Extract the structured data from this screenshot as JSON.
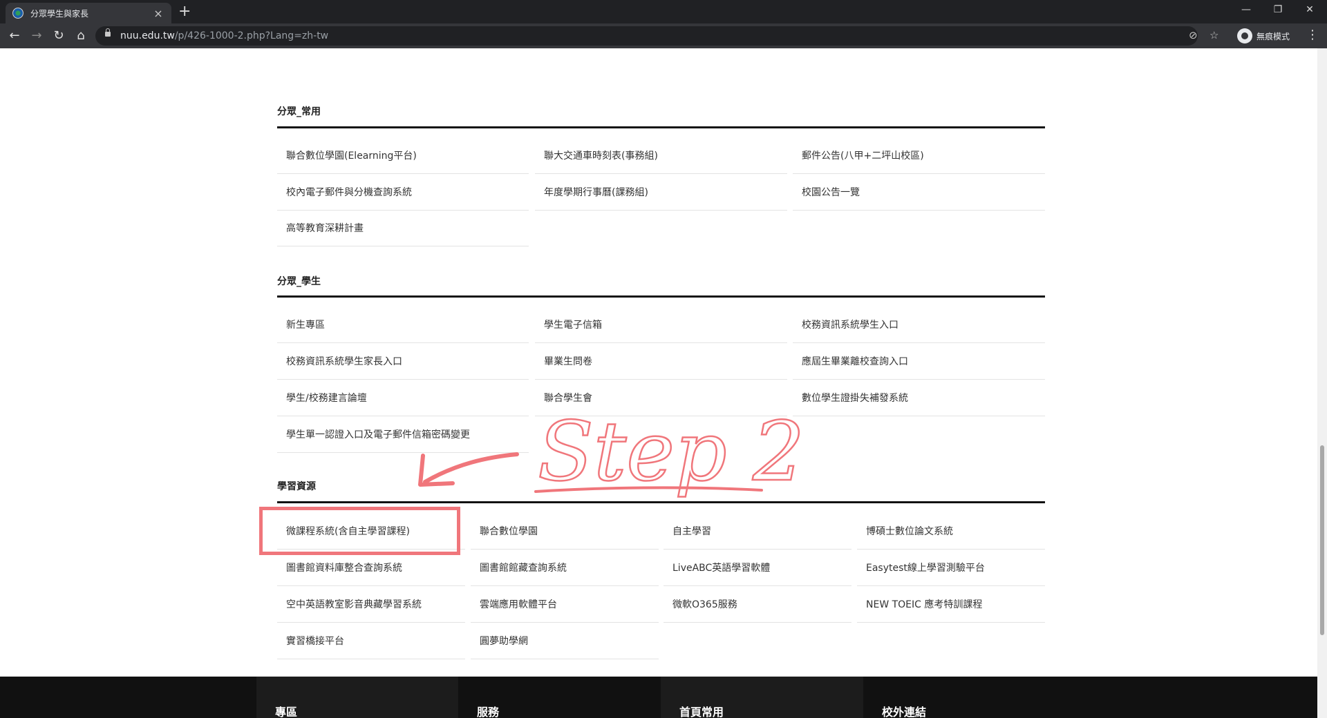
{
  "browser": {
    "tab_title": "分眾學生與家長",
    "url_host": "nuu.edu.tw",
    "url_path": "/p/426-1000-2.php?Lang=zh-tw",
    "profile_label": "無痕模式"
  },
  "sections": [
    {
      "heading": "分眾_常用",
      "links": [
        "聯合數位學園(Elearning平台)",
        "聯大交通車時刻表(事務組)",
        "郵件公告(八甲+二坪山校區)",
        "校內電子郵件與分機查詢系統",
        "年度學期行事曆(課務組)",
        "校園公告一覽",
        "高等教育深耕計畫"
      ]
    },
    {
      "heading": "分眾_學生",
      "links": [
        "新生專區",
        "學生電子信箱",
        "校務資訊系統學生入口",
        "校務資訊系統學生家長入口",
        "畢業生問卷",
        "應屆生畢業離校查詢入口",
        "學生/校務建言論壇",
        "聯合學生會",
        "數位學生證掛失補發系統",
        "學生單一認證入口及電子郵件信箱密碼變更"
      ]
    },
    {
      "heading": "學習資源",
      "links": [
        "微課程系統(含自主學習課程)",
        "聯合數位學園",
        "自主學習",
        "博碩士數位論文系統",
        "圖書館資料庫整合查詢系統",
        "圖書館館藏查詢系統",
        "LiveABC英語學習軟體",
        "Easytest線上學習測驗平台",
        "空中英語教室影音典藏學習系統",
        "雲端應用軟體平台",
        "微軟O365服務",
        "NEW TOEIC 應考特訓課程",
        "實習橋接平台",
        "圓夢助學網"
      ]
    }
  ],
  "footer": [
    "專區",
    "服務",
    "首頁常用",
    "校外連結"
  ],
  "annotation": {
    "text": "Step 2",
    "color": "#f0767b"
  }
}
